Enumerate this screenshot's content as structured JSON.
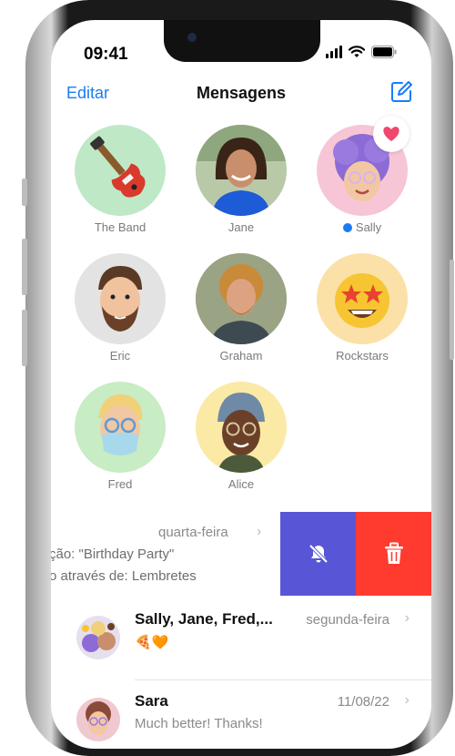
{
  "status_bar": {
    "time": "09:41"
  },
  "nav": {
    "edit": "Editar",
    "title": "Mensagens",
    "compose_icon": "compose-icon"
  },
  "pinned": [
    {
      "name": "The Band",
      "bg": "#bfe8c7",
      "icon": "guitar-icon"
    },
    {
      "name": "Jane",
      "bg": "#cfd8cf",
      "icon": "photo-avatar"
    },
    {
      "name": "Sally",
      "bg": "#f7c6d6",
      "icon": "memoji-avatar",
      "unread": true,
      "badge": "heart-icon"
    },
    {
      "name": "Eric",
      "bg": "#e3e3e3",
      "icon": "memoji-avatar"
    },
    {
      "name": "Graham",
      "bg": "#a8b08f",
      "icon": "photo-avatar"
    },
    {
      "name": "Rockstars",
      "bg": "#fbe0a8",
      "icon": "star-struck-emoji"
    },
    {
      "name": "Fred",
      "bg": "#c8ecc4",
      "icon": "memoji-avatar"
    },
    {
      "name": "Alice",
      "bg": "#fbe9a6",
      "icon": "memoji-avatar"
    }
  ],
  "swiped_row": {
    "date": "quarta-feira",
    "line1": "ção: \"Birthday Party\"",
    "line2": "o através de: Lembretes",
    "actions": {
      "mute_icon": "bell-slash-icon",
      "delete_icon": "trash-icon"
    }
  },
  "messages": [
    {
      "name": "Sally, Jane, Fred,...",
      "date": "segunda-feira",
      "preview": "🍕🧡"
    },
    {
      "name": "Sara",
      "date": "11/08/22",
      "preview": "Much better! Thanks!"
    }
  ],
  "colors": {
    "accent": "#1a7cf5",
    "mute": "#5856d6",
    "delete": "#ff3b30"
  }
}
